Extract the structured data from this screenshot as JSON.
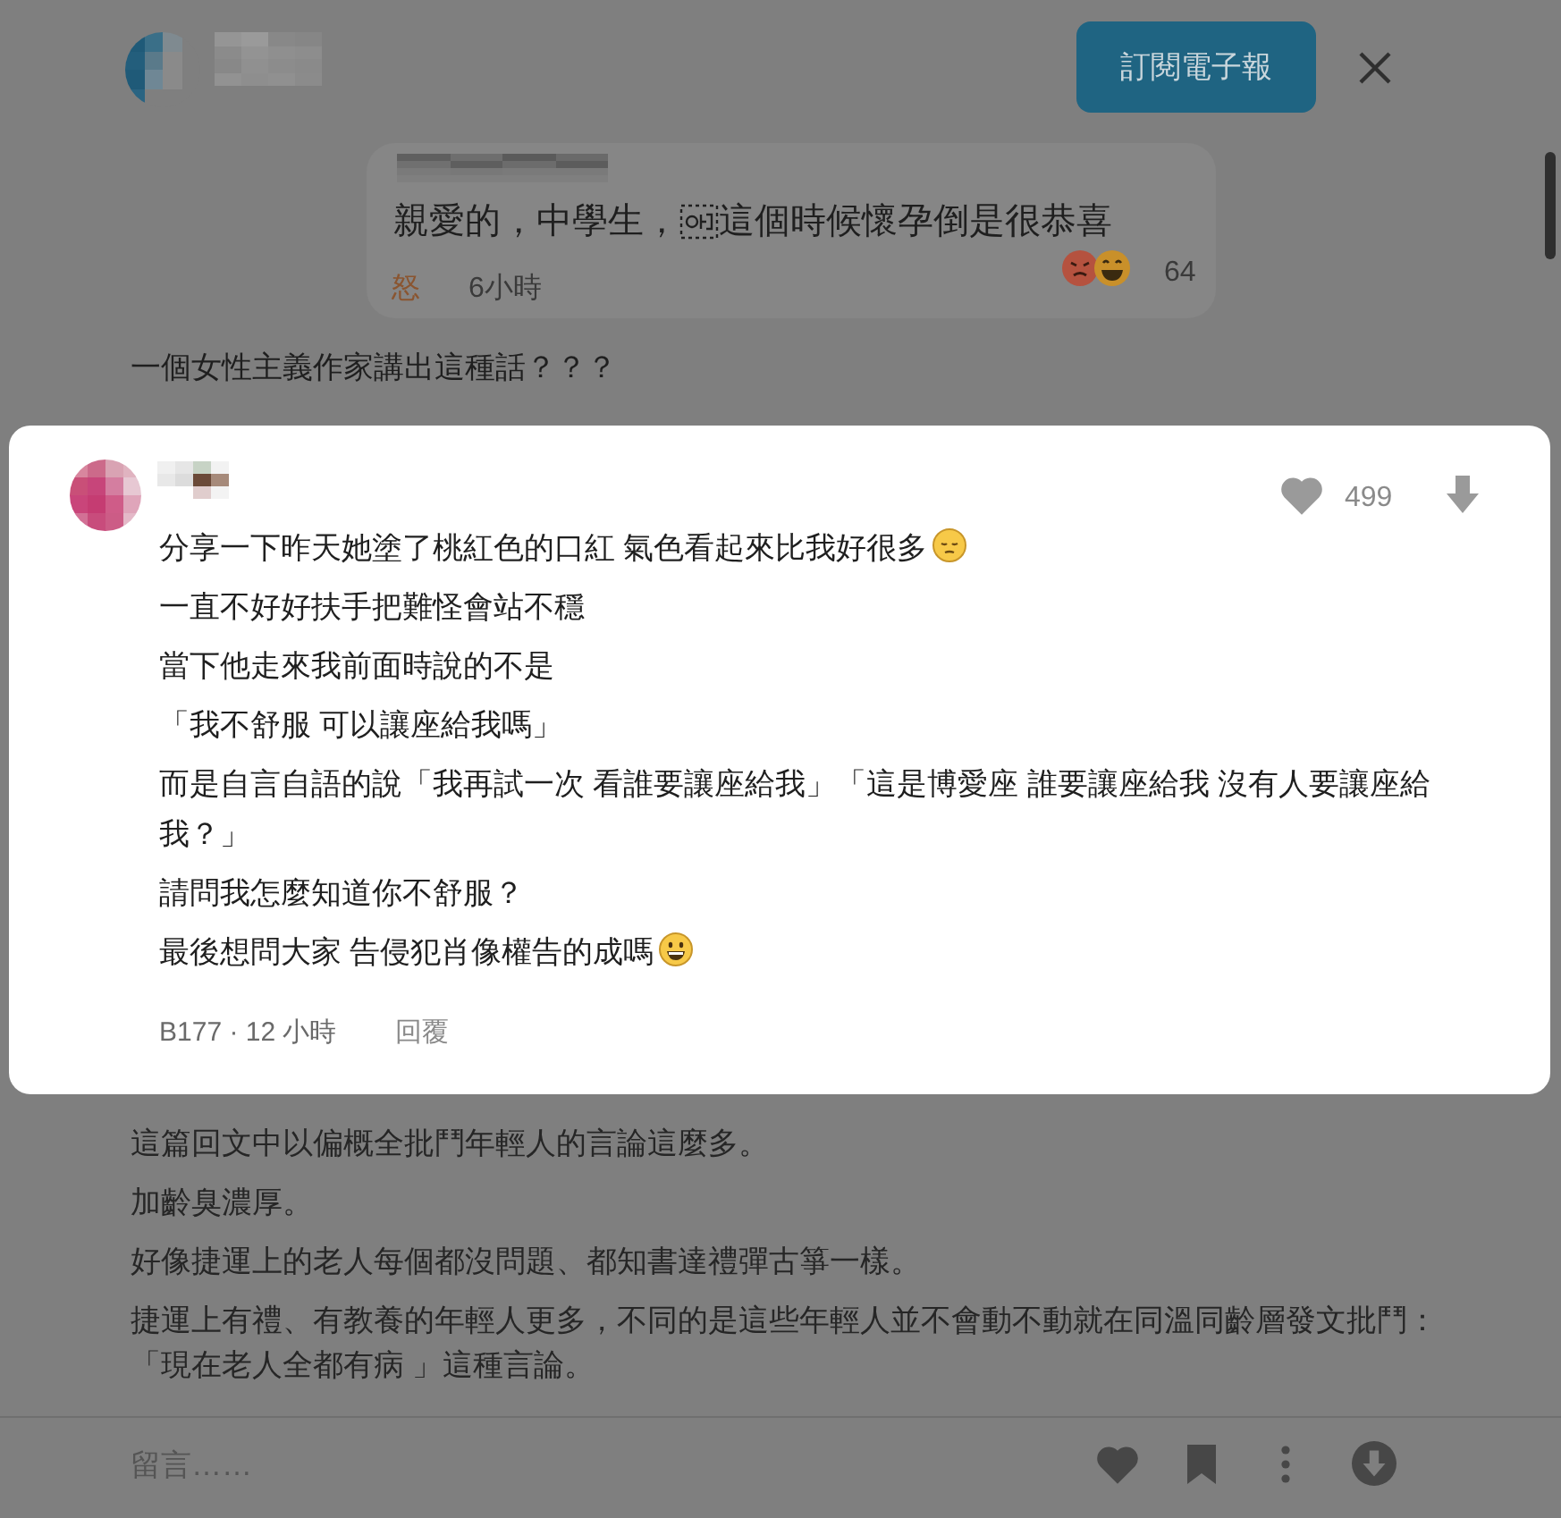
{
  "header": {
    "subscribe_button": "訂閱電子報"
  },
  "quoted_comment": {
    "text_parts": [
      "親愛的，中學生，",
      "這個時候懷孕倒是很恭喜"
    ],
    "reaction_label": "怒",
    "time": "6小時",
    "reaction_count": "64"
  },
  "post_line": "一個女性主義作家講出這種話？？？",
  "comment_card": {
    "likes": "499",
    "lines": [
      {
        "text": "分享一下昨天她塗了桃紅色的口紅 氣色看起來比我好很多",
        "kind": "pensive"
      },
      {
        "text": "一直不好好扶手把難怪會站不穩",
        "kind": "plain"
      },
      {
        "text": "當下他走來我前面時說的不是",
        "kind": "plain"
      },
      {
        "text": "「我不舒服 可以讓座給我嗎」",
        "kind": "plain"
      },
      {
        "text": "而是自言自語的說「我再試一次 看誰要讓座給我」「這是博愛座 誰要讓座給我 沒有人要讓座給我？」",
        "kind": "plain"
      },
      {
        "text": "請問我怎麼知道你不舒服？",
        "kind": "plain"
      },
      {
        "text": "最後想問大家 告侵犯肖像權告的成嗎",
        "kind": "grin"
      }
    ],
    "meta": "B177 · 12 小時",
    "reply_link": "回覆"
  },
  "post_body": [
    "這篇回文中以偏概全批鬥年輕人的言論這麼多。",
    "加齡臭濃厚。",
    "好像捷運上的老人每個都沒問題、都知書達禮彈古箏一樣。",
    "捷運上有禮、有教養的年輕人更多，不同的是這些年輕人並不會動不動就在同溫同齡層發文批鬥：「現在老人全都有病 」這種言論。"
  ],
  "comment_bar": {
    "placeholder": "留言……"
  }
}
